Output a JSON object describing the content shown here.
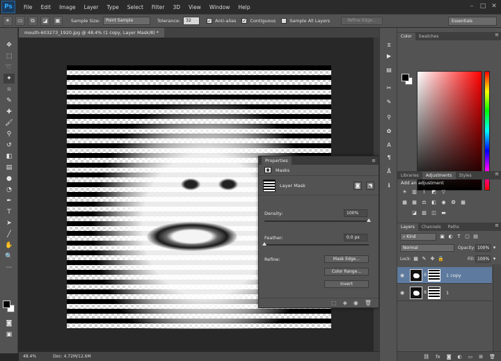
{
  "app": {
    "logo": "Ps"
  },
  "menu": [
    "File",
    "Edit",
    "Image",
    "Layer",
    "Type",
    "Select",
    "Filter",
    "3D",
    "View",
    "Window",
    "Help"
  ],
  "window_controls": [
    "–",
    "□",
    "✕"
  ],
  "options": {
    "sample_size_label": "Sample Size:",
    "sample_size_value": "Point Sample",
    "tolerance_label": "Tolerance:",
    "tolerance_value": "32",
    "anti_alias_label": "Anti-alias",
    "contiguous_label": "Contiguous",
    "sample_all_layers_label": "Sample All Layers",
    "refine_edge_label": "Refine Edge...",
    "workspace": "Essentials"
  },
  "document": {
    "tab_title": "mouth-603273_1920.jpg @ 48.4% (1 copy, Layer Mask/8) *",
    "zoom": "48.4%",
    "doc_info": "Doc: 4.72M/12.6M"
  },
  "properties": {
    "title": "Properties",
    "masks_label": "Masks",
    "layer_mask_label": "Layer Mask",
    "density_label": "Density:",
    "density_value": "100%",
    "density_fraction": 1.0,
    "feather_label": "Feather:",
    "feather_value": "0.0 px",
    "feather_fraction": 0.0,
    "refine_label": "Refine:",
    "mask_edge_button": "Mask Edge...",
    "color_range_button": "Color Range...",
    "invert_button": "Invert"
  },
  "color_panel": {
    "tabs": [
      "Color",
      "Swatches"
    ],
    "foreground": "#000000",
    "background": "#ffffff"
  },
  "adjustments_panel": {
    "tabs": [
      "Libraries",
      "Adjustments",
      "Styles"
    ],
    "title": "Add an adjustment"
  },
  "layers_panel": {
    "tabs": [
      "Layers",
      "Channels",
      "Paths"
    ],
    "kind_label": "Kind",
    "blend_mode": "Normal",
    "opacity_label": "Opacity:",
    "opacity_value": "100%",
    "lock_label": "Lock:",
    "fill_label": "Fill:",
    "fill_value": "100%",
    "layers": [
      {
        "name": "1 copy",
        "selected": true
      },
      {
        "name": "1",
        "selected": false
      }
    ]
  },
  "icons": {
    "tools": [
      "move-icon",
      "marquee-icon",
      "lasso-icon",
      "magic-wand-icon",
      "crop-icon",
      "eyedropper-icon",
      "healing-brush-icon",
      "brush-icon",
      "clone-stamp-icon",
      "history-brush-icon",
      "eraser-icon",
      "gradient-icon",
      "blur-icon",
      "dodge-icon",
      "pen-icon",
      "type-icon",
      "path-selection-icon",
      "line-icon",
      "hand-icon",
      "zoom-icon",
      "more-tools-icon"
    ]
  }
}
